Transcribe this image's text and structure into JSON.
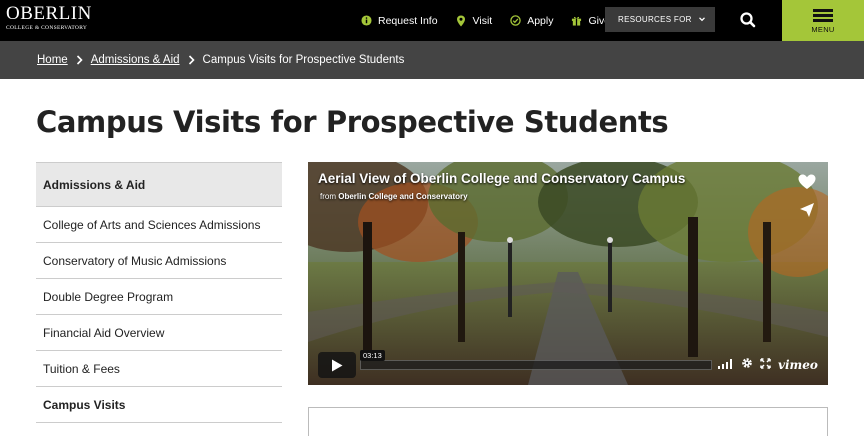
{
  "header": {
    "logo_main": "OBERLIN",
    "logo_sub": "COLLEGE & CONSERVATORY",
    "links": [
      {
        "label": "Request Info",
        "icon": "info-icon"
      },
      {
        "label": "Visit",
        "icon": "map-pin-icon"
      },
      {
        "label": "Apply",
        "icon": "check-circle-icon"
      },
      {
        "label": "Give",
        "icon": "gift-icon"
      }
    ],
    "resources_label": "RESOURCES FOR",
    "menu_label": "MENU",
    "accent_color": "#a4c639"
  },
  "breadcrumb": {
    "items": [
      "Home",
      "Admissions & Aid",
      "Campus Visits for Prospective Students"
    ]
  },
  "page": {
    "title": "Campus Visits for Prospective Students"
  },
  "sidenav": {
    "heading": "Admissions & Aid",
    "items": [
      "College of Arts and Sciences Admissions",
      "Conservatory of Music Admissions",
      "Double Degree Program",
      "Financial Aid Overview",
      "Tuition & Fees",
      "Campus Visits"
    ]
  },
  "video": {
    "title": "Aerial View of Oberlin College and Conservatory Campus",
    "from_prefix": "from",
    "from_name": "Oberlin College and Conservatory",
    "timestamp": "03:13",
    "brand": "vimeo"
  }
}
